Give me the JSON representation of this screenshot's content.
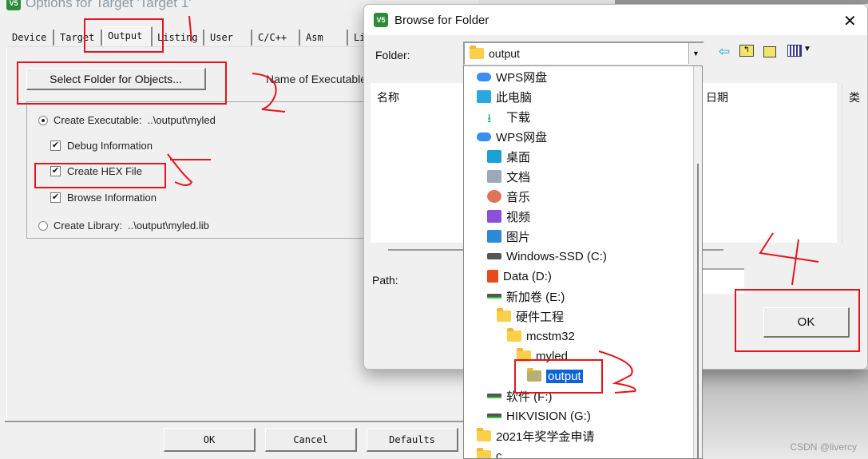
{
  "options_dialog": {
    "title": "Options for Target 'Target 1'",
    "tabs": [
      "Device",
      "Target",
      "Output",
      "Listing",
      "User",
      "C/C++",
      "Asm",
      "Li"
    ],
    "active_tab": "Output",
    "select_folder_button": "Select Folder for Objects...",
    "name_of_executable_label": "Name of Executable",
    "create_executable": {
      "label": "Create Executable:",
      "value": "..\\output\\myled",
      "selected": true
    },
    "debug_information": {
      "label": "Debug Information",
      "checked": true
    },
    "create_hex_file": {
      "label": "Create HEX File",
      "checked": true
    },
    "browse_information": {
      "label": "Browse Information",
      "checked": true
    },
    "create_library": {
      "label": "Create Library:",
      "value": "..\\output\\myled.lib",
      "selected": false
    },
    "buttons": {
      "ok": "OK",
      "cancel": "Cancel",
      "defaults": "Defaults"
    }
  },
  "browse_dialog": {
    "title": "Browse for Folder",
    "folder_label": "Folder:",
    "folder_value": "output",
    "columns": [
      "名称",
      "日期",
      "类"
    ],
    "path_label": "Path:",
    "ok_button": "OK",
    "dropdown_items": [
      {
        "label": "WPS网盘",
        "icon": "cloud-icon"
      },
      {
        "label": "此电脑",
        "icon": "computer-icon"
      },
      {
        "label": "下载",
        "icon": "download-icon"
      },
      {
        "label": "WPS网盘",
        "icon": "cloud-icon"
      },
      {
        "label": "桌面",
        "icon": "desktop-icon"
      },
      {
        "label": "文档",
        "icon": "document-icon"
      },
      {
        "label": "音乐",
        "icon": "music-icon"
      },
      {
        "label": "视频",
        "icon": "video-icon"
      },
      {
        "label": "图片",
        "icon": "picture-icon"
      },
      {
        "label": "Windows-SSD (C:)",
        "icon": "windows-drive-icon"
      },
      {
        "label": "Data (D:)",
        "icon": "office-icon"
      },
      {
        "label": "新加卷 (E:)",
        "icon": "drive-icon"
      },
      {
        "label": "硬件工程",
        "icon": "folder-icon"
      },
      {
        "label": "mcstm32",
        "icon": "folder-icon"
      },
      {
        "label": "myled",
        "icon": "folder-icon"
      },
      {
        "label": "output",
        "icon": "folder-icon",
        "selected": true
      },
      {
        "label": "软件 (F:)",
        "icon": "drive-icon"
      },
      {
        "label": "HIKVISION (G:)",
        "icon": "drive-icon"
      },
      {
        "label": "2021年奖学金申请",
        "icon": "folder-icon"
      },
      {
        "label": "c",
        "icon": "folder-icon"
      }
    ]
  },
  "watermark": "CSDN @livercy",
  "annotation_color": "#e8141c"
}
